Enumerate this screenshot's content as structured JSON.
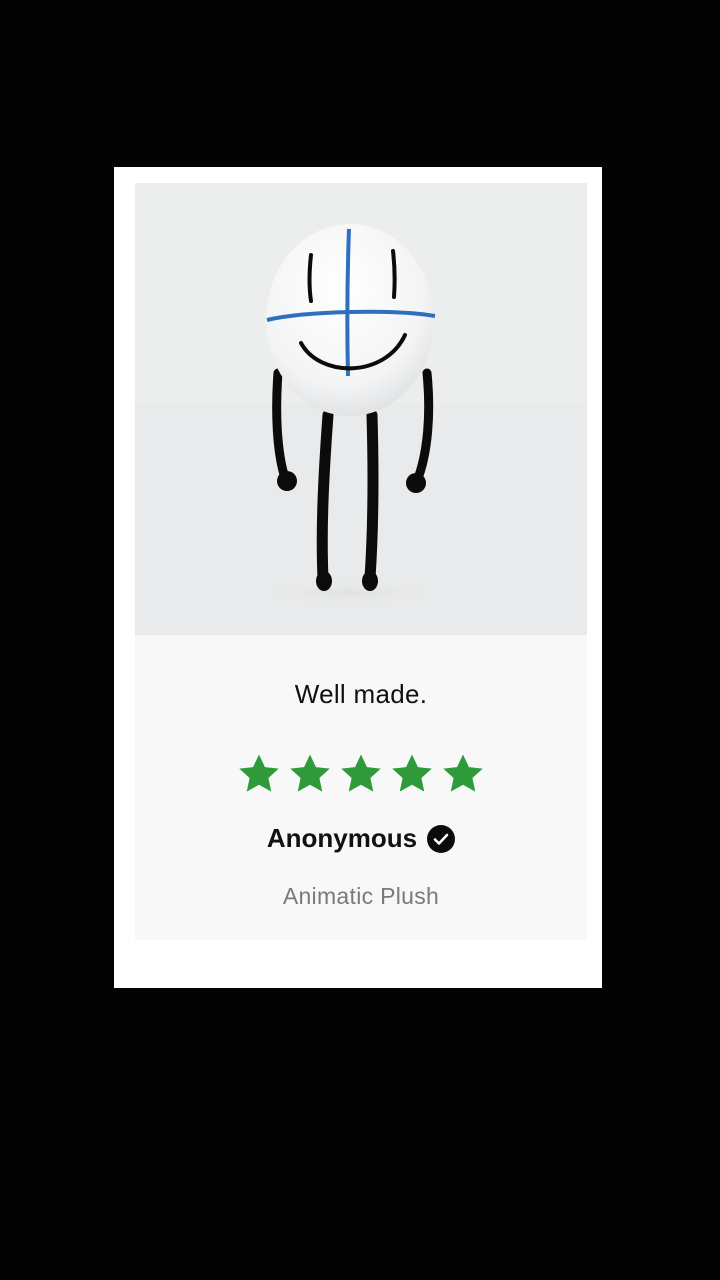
{
  "review": {
    "text": "Well made.",
    "rating": 5,
    "rating_max": 5,
    "reviewer": "Anonymous",
    "verified": true,
    "product": "Animatic Plush"
  },
  "icons": {
    "star": "star-icon",
    "verified": "verified-check-icon"
  },
  "colors": {
    "background": "#030303",
    "card": "#ffffff",
    "panel": "#f8f8f8",
    "star": "#2e9a3a",
    "text": "#111111",
    "muted": "#7a7a7a",
    "plush_line": "#2f6fc0"
  }
}
